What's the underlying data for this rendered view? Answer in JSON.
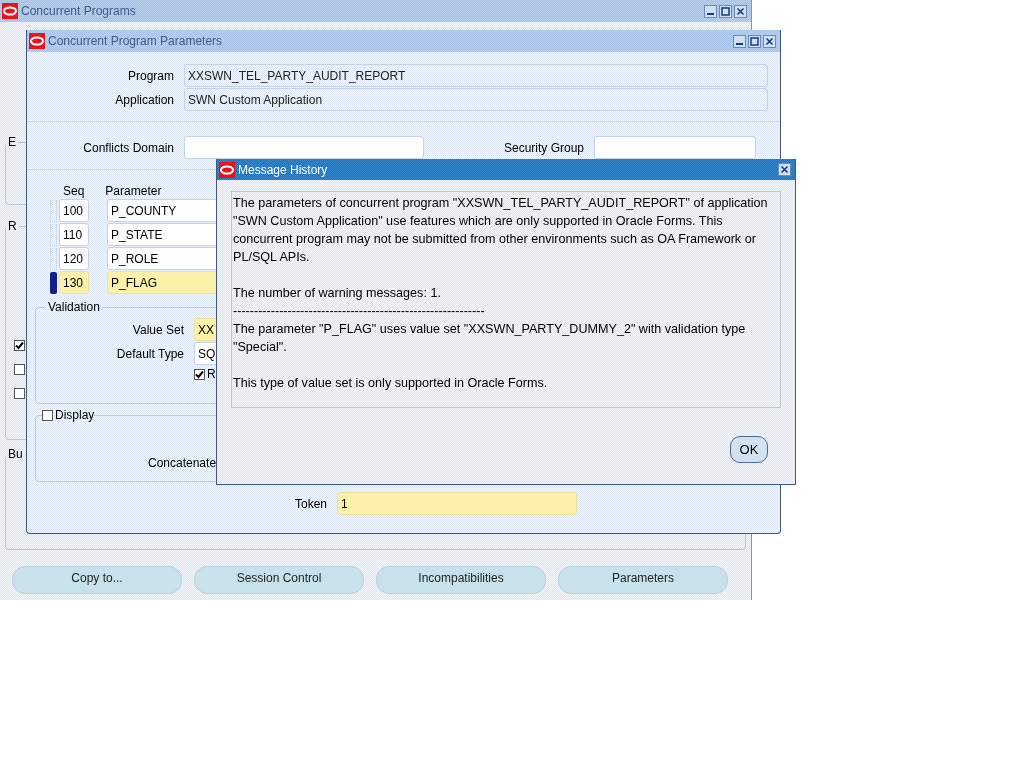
{
  "main_window": {
    "title": "Concurrent Programs",
    "active": false,
    "groups": [
      {
        "label": "E"
      },
      {
        "label": "R"
      },
      {
        "label": "Bu"
      }
    ],
    "checkboxes": [
      {
        "checked": true
      },
      {
        "checked": false
      },
      {
        "checked": false
      }
    ],
    "buttons": [
      "Copy to...",
      "Session Control",
      "Incompatibilities",
      "Parameters"
    ]
  },
  "parameters_window": {
    "title": "Concurrent Program Parameters",
    "active": false,
    "program": {
      "label": "Program",
      "value": "XXSWN_TEL_PARTY_AUDIT_REPORT"
    },
    "application": {
      "label": "Application",
      "value": "SWN Custom Application"
    },
    "conflicts_domain": {
      "label": "Conflicts Domain"
    },
    "security_group": {
      "label": "Security Group"
    },
    "columns": [
      "Seq",
      "Parameter"
    ],
    "rows": [
      {
        "seq": "100",
        "parameter": "P_COUNTY",
        "selected": false
      },
      {
        "seq": "110",
        "parameter": "P_STATE",
        "selected": false
      },
      {
        "seq": "120",
        "parameter": "P_ROLE",
        "selected": false
      },
      {
        "seq": "130",
        "parameter": "P_FLAG",
        "selected": true
      }
    ],
    "validation": {
      "title": "Validation",
      "value_set": {
        "label": "Value Set",
        "value": "XX"
      },
      "default_type": {
        "label": "Default Type",
        "value": "SQ"
      },
      "checkbox": {
        "label": "R",
        "checked": true
      }
    },
    "display": {
      "label": "Display",
      "checked": false,
      "concatenate_label": "Concatenate"
    },
    "token": {
      "label": "Token",
      "value": "1"
    }
  },
  "message_dialog": {
    "title": "Message History",
    "active": true,
    "paragraphs": [
      "The parameters of concurrent program \"XXSWN_TEL_PARTY_AUDIT_REPORT\" of application \"SWN Custom Application\" use features which are only supported in Oracle Forms. This concurrent program may not be submitted from other environments such as OA Framework or PL/SQL APIs.",
      "The number of warning messages: 1.",
      "------------------------------------------------------------",
      "The parameter \"P_FLAG\" uses value set \"XXSWN_PARTY_DUMMY_2\" with validation type \"Special\".",
      "This type of value set is only supported in Oracle Forms."
    ],
    "button": "OK"
  }
}
